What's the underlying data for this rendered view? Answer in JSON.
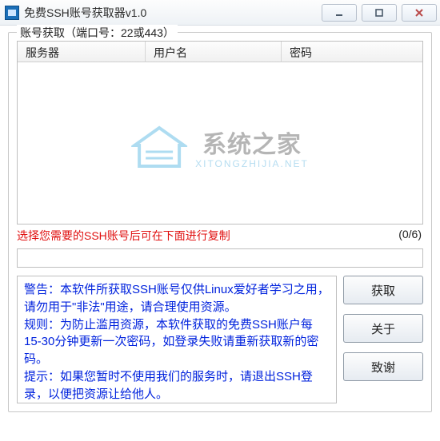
{
  "window": {
    "title": "免费SSH账号获取器v1.0"
  },
  "group": {
    "label": "账号获取（端口号：22或443）"
  },
  "table": {
    "columns": [
      "服务器",
      "用户名",
      "密码"
    ],
    "rows": []
  },
  "watermark": {
    "title": "系统之家",
    "subtitle": "XITONGZHIJIA.NET"
  },
  "tip": "选择您需要的SSH账号后可在下面进行复制",
  "counter": "(0/6)",
  "copy_value": "",
  "info": {
    "line1": "警告：本软件所获取SSH账号仅供Linux爱好者学习之用，请勿用于\"非法\"用途，请合理使用资源。",
    "line2": "规则：为防止滥用资源，本软件获取的免费SSH账户每15-30分钟更新一次密码，如登录失败请重新获取新的密码。",
    "line3": "提示：如果您暂时不使用我们的服务时，请退出SSH登录，以便把资源让给他人。"
  },
  "buttons": {
    "fetch": "获取",
    "about": "关于",
    "thanks": "致谢"
  }
}
